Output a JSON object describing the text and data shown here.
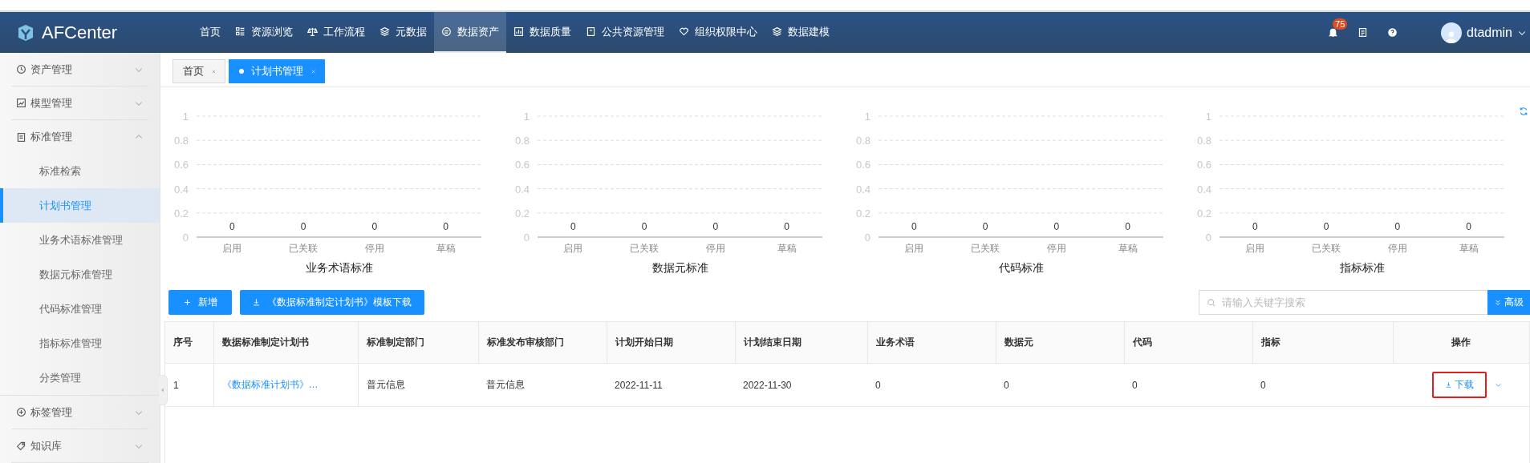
{
  "header": {
    "logo": "AFCenter",
    "nav": [
      {
        "label": "首页",
        "selected": false
      },
      {
        "label": "资源浏览",
        "selected": false
      },
      {
        "label": "工作流程",
        "selected": false
      },
      {
        "label": "元数据",
        "selected": false
      },
      {
        "label": "数据资产",
        "selected": true
      },
      {
        "label": "数据质量",
        "selected": false
      },
      {
        "label": "公共资源管理",
        "selected": false
      },
      {
        "label": "组织权限中心",
        "selected": false
      },
      {
        "label": "数据建模",
        "selected": false
      }
    ],
    "notification_count": "75",
    "user": "dtadmin"
  },
  "sidebar": {
    "items": [
      {
        "label": "资产管理",
        "expanded": false
      },
      {
        "label": "模型管理",
        "expanded": false
      },
      {
        "label": "标准管理",
        "expanded": true,
        "children": [
          {
            "label": "标准检索",
            "selected": false
          },
          {
            "label": "计划书管理",
            "selected": true
          },
          {
            "label": "业务术语标准管理",
            "selected": false
          },
          {
            "label": "数据元标准管理",
            "selected": false
          },
          {
            "label": "代码标准管理",
            "selected": false
          },
          {
            "label": "指标标准管理",
            "selected": false
          },
          {
            "label": "分类管理",
            "selected": false
          }
        ]
      },
      {
        "label": "标签管理",
        "expanded": false
      },
      {
        "label": "知识库",
        "expanded": false
      }
    ]
  },
  "tabs": [
    {
      "label": "首页",
      "selected": false
    },
    {
      "label": "计划书管理",
      "selected": true
    }
  ],
  "charts": [
    {
      "chart_data": {
        "type": "bar",
        "title": "业务术语标准",
        "grid": true,
        "categories": [
          "启用",
          "已关联",
          "停用",
          "草稿"
        ],
        "values": [
          0,
          0,
          0,
          0
        ],
        "ylim": [
          0,
          1
        ],
        "yticks": [
          0,
          0.2,
          0.4,
          0.6,
          0.8,
          1
        ],
        "data_labels": true
      }
    },
    {
      "chart_data": {
        "type": "bar",
        "title": "数据元标准",
        "grid": true,
        "categories": [
          "启用",
          "已关联",
          "停用",
          "草稿"
        ],
        "values": [
          0,
          0,
          0,
          0
        ],
        "ylim": [
          0,
          1
        ],
        "yticks": [
          0,
          0.2,
          0.4,
          0.6,
          0.8,
          1
        ],
        "data_labels": true
      }
    },
    {
      "chart_data": {
        "type": "bar",
        "title": "代码标准",
        "grid": true,
        "categories": [
          "启用",
          "已关联",
          "停用",
          "草稿"
        ],
        "values": [
          0,
          0,
          0,
          0
        ],
        "ylim": [
          0,
          1
        ],
        "yticks": [
          0,
          0.2,
          0.4,
          0.6,
          0.8,
          1
        ],
        "data_labels": true
      }
    },
    {
      "chart_data": {
        "type": "bar",
        "title": "指标标准",
        "grid": true,
        "categories": [
          "启用",
          "已关联",
          "停用",
          "草稿"
        ],
        "values": [
          0,
          0,
          0,
          0
        ],
        "ylim": [
          0,
          1
        ],
        "yticks": [
          0,
          0.2,
          0.4,
          0.6,
          0.8,
          1
        ],
        "data_labels": true
      }
    }
  ],
  "toolbar": {
    "buttons": [
      "新增",
      "《数据标准制定计划书》模板下载"
    ],
    "search": {
      "placeholder": "请输入关键字搜索"
    },
    "advanced_button": "高级"
  },
  "table": {
    "columns": [
      {
        "label": "序号",
        "kind": "text"
      },
      {
        "label": "数据标准制定计划书",
        "kind": "link"
      },
      {
        "label": "标准制定部门",
        "kind": "text"
      },
      {
        "label": "标准发布审核部门",
        "kind": "text"
      },
      {
        "label": "计划开始日期",
        "kind": "text"
      },
      {
        "label": "计划结束日期",
        "kind": "text"
      },
      {
        "label": "业务术语",
        "kind": "text"
      },
      {
        "label": "数据元",
        "kind": "text"
      },
      {
        "label": "代码",
        "kind": "text"
      },
      {
        "label": "指标",
        "kind": "text"
      },
      {
        "label": "操作",
        "kind": "action"
      }
    ],
    "rows": [
      {
        "cells": [
          "1",
          "《数据标准计划书》…",
          "普元信息",
          "普元信息",
          "2022-11-11",
          "2022-11-30",
          "0",
          "0",
          "0",
          "0"
        ],
        "action": {
          "label": "下载",
          "highlighted": true
        }
      }
    ]
  }
}
